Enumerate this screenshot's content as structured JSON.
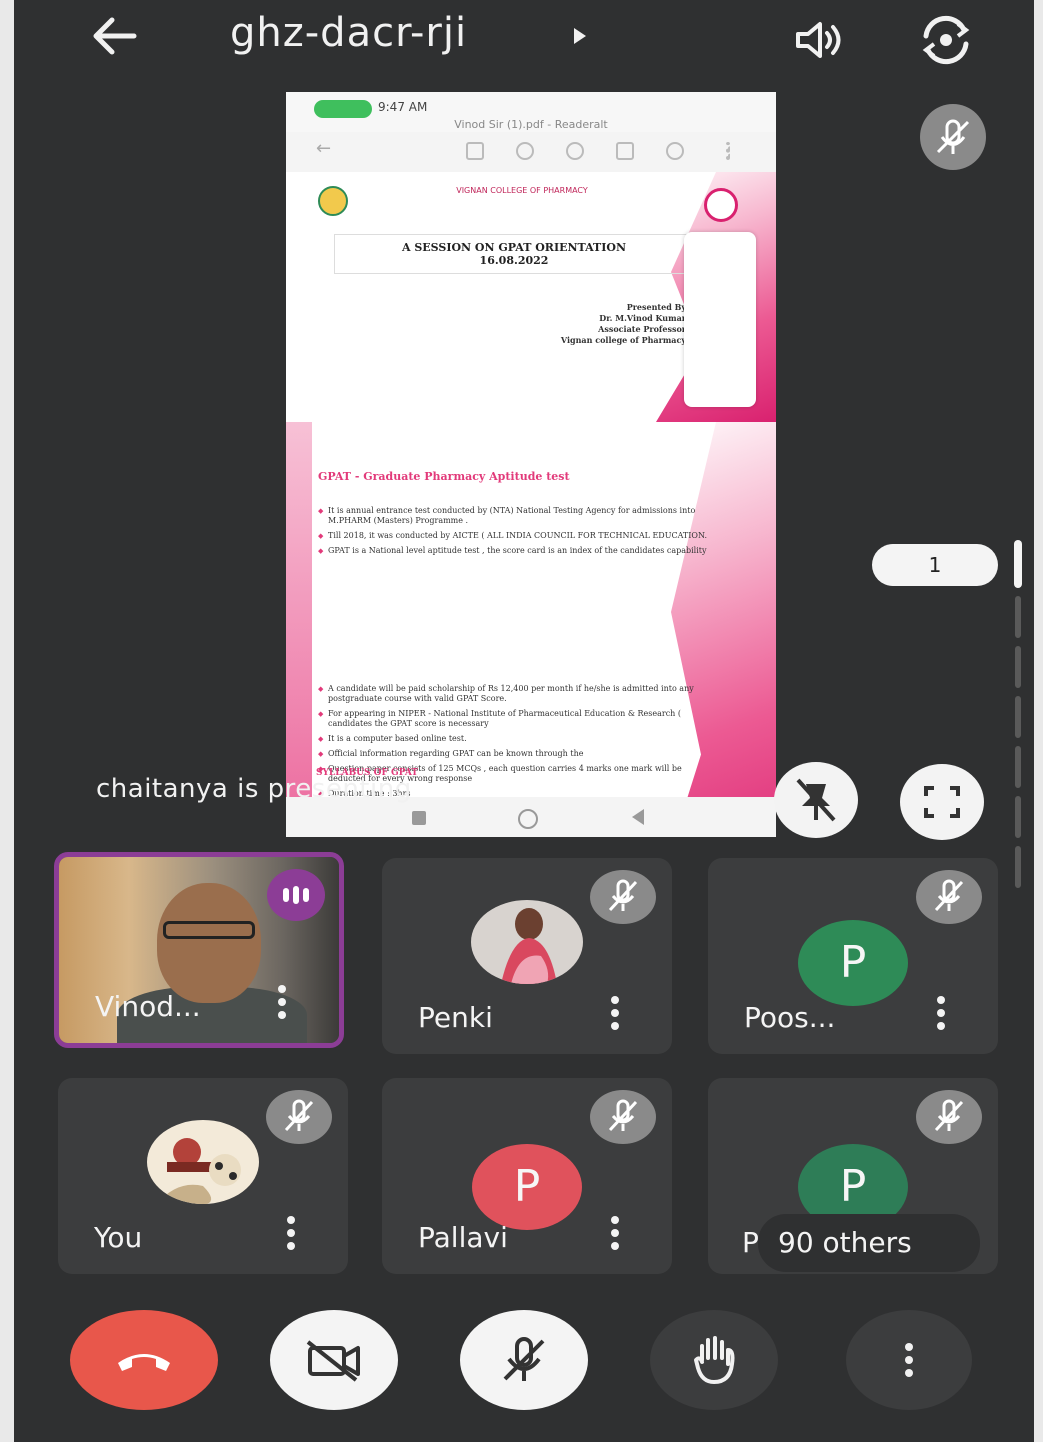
{
  "header": {
    "meeting_code": "ghz-dacr-rji"
  },
  "presentation": {
    "phone_time": "9:47 AM",
    "doc_name": "Vinod Sir (1).pdf - Readeralt",
    "college_line": "VIGNAN COLLEGE OF PHARMACY",
    "session_title": "A SESSION ON GPAT ORIENTATION",
    "session_date": "16.08.2022",
    "presented_lines": [
      "Presented By",
      "Dr. M.Vinod Kumar",
      "Associate Professor",
      "Vignan college of Pharmacy"
    ],
    "gpat_heading": "GPAT - Graduate Pharmacy Aptitude test",
    "bullets_1": [
      "It is annual entrance test conducted by (NTA) National Testing Agency for admissions into M.PHARM (Masters) Programme .",
      "Till 2018, it was conducted by AICTE ( ALL INDIA COUNCIL FOR TECHNICAL EDUCATION.",
      "GPAT is a National level aptitude test , the score card is an index of the candidates capability"
    ],
    "bullets_2": [
      "A candidate will be paid scholarship of Rs 12,400 per month if he/she is admitted into any postgraduate course with valid GPAT Score.",
      "For appearing in NIPER - National Institute of Pharmaceutical Education & Research ( candidates the GPAT score is necessary",
      "It is a computer based online test.",
      "Official information regarding GPAT can be known through the",
      "Question paper consists of 125 MCQs , each question carries 4 marks one mark will be deducted for every wrong response",
      "Duration time : 3hrs"
    ],
    "syllabus_heading": "SYLLABUS OF GPAT",
    "presenting_text": "chaitanya is presenting",
    "page_number": "1"
  },
  "participants": [
    {
      "name": "Vinod...",
      "type": "video",
      "speaking": true
    },
    {
      "name": "Penki",
      "type": "photo",
      "muted": true
    },
    {
      "name": "Poos...",
      "type": "initial",
      "initial": "P",
      "color": "#2e8b57",
      "muted": true
    },
    {
      "name": "You",
      "type": "photo",
      "muted": true
    },
    {
      "name": "Pallavi",
      "type": "initial",
      "initial": "P",
      "color": "#e0525c",
      "muted": true
    },
    {
      "name": "P",
      "type": "initial",
      "initial": "P",
      "color": "#2e7d57",
      "muted": true
    }
  ],
  "others_label": "90 others",
  "colors": {
    "background": "#2f3031",
    "tile": "#3c3d3e",
    "speaking_accent": "#8c3d96",
    "hangup": "#e8574b"
  },
  "icons": [
    "back-arrow-icon",
    "speaker-icon",
    "camera-flip-icon",
    "mic-off-icon",
    "unpin-icon",
    "fullscreen-icon",
    "hangup-icon",
    "camera-off-icon",
    "raise-hand-icon",
    "more-icon"
  ]
}
